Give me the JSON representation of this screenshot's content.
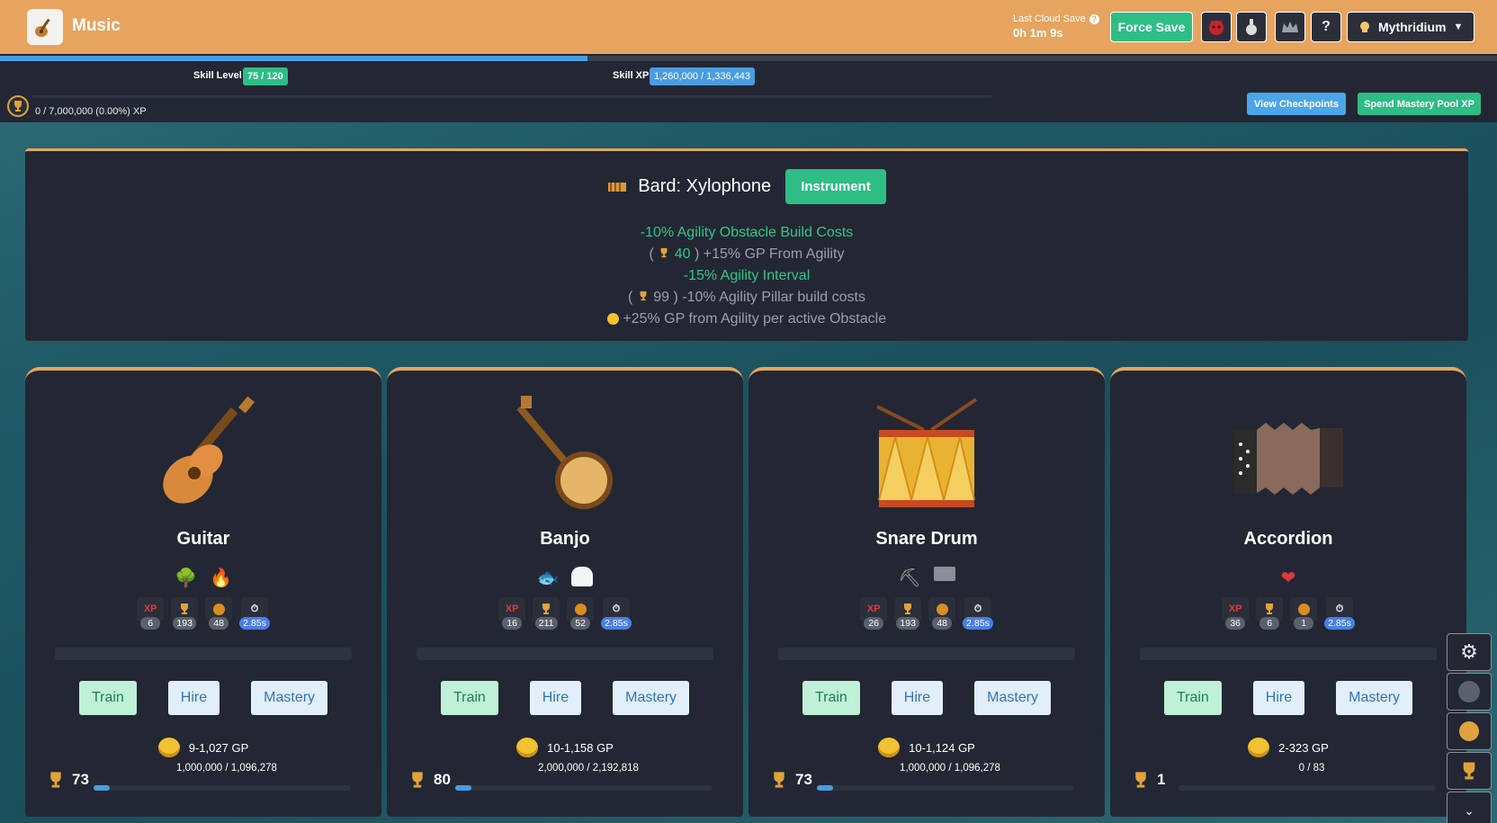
{
  "header": {
    "title": "Music",
    "cloud_label": "Last Cloud Save",
    "cloud_value": "0h 1m 9s",
    "force_save": "Force Save",
    "help_label": "?",
    "account": "Mythridium"
  },
  "skill": {
    "level_label": "Skill Level",
    "level_value": "75 / 120",
    "xp_label": "Skill XP",
    "xp_value": "1,260,000 / 1,336,443",
    "pool_text": "0 / 7,000,000 (0.00%) XP",
    "view_checkpoints": "View Checkpoints",
    "spend_pool": "Spend Mastery Pool XP"
  },
  "bard": {
    "title": "Bard: Xylophone",
    "instrument_btn": "Instrument",
    "mod1": "-10% Agility Obstacle Build Costs",
    "mod2_open": "(",
    "mod2_level": "40",
    "mod2_rest": ") +15% GP From Agility",
    "mod3": "-15% Agility Interval",
    "mod4_open": "(",
    "mod4_level": "99",
    "mod4_rest": ") -10% Agility Pillar build costs",
    "mod5": "+25% GP from Agility per active Obstacle"
  },
  "cards": [
    {
      "name": "Guitar",
      "xp": "6",
      "mastery_xp": "193",
      "pool": "48",
      "interval": "2.85s",
      "train": "Train",
      "hire": "Hire",
      "mastery": "Mastery",
      "gp": "9-1,027 GP",
      "mastery_level": "73",
      "mastery_progress": "1,000,000 / 1,096,278"
    },
    {
      "name": "Banjo",
      "xp": "16",
      "mastery_xp": "211",
      "pool": "52",
      "interval": "2.85s",
      "train": "Train",
      "hire": "Hire",
      "mastery": "Mastery",
      "gp": "10-1,158 GP",
      "mastery_level": "80",
      "mastery_progress": "2,000,000 / 2,192,818"
    },
    {
      "name": "Snare Drum",
      "xp": "26",
      "mastery_xp": "193",
      "pool": "48",
      "interval": "2.85s",
      "train": "Train",
      "hire": "Hire",
      "mastery": "Mastery",
      "gp": "10-1,124 GP",
      "mastery_level": "73",
      "mastery_progress": "1,000,000 / 1,096,278"
    },
    {
      "name": "Accordion",
      "xp": "36",
      "mastery_xp": "6",
      "pool": "1",
      "interval": "2.85s",
      "train": "Train",
      "hire": "Hire",
      "mastery": "Mastery",
      "gp": "2-323 GP",
      "mastery_level": "1",
      "mastery_progress": "0 / 83"
    }
  ],
  "stat_xp_label": "XP",
  "colors": {
    "header": "#e6a45f",
    "green": "#2ebd85",
    "blue": "#4a9de0",
    "panel": "#232733"
  }
}
